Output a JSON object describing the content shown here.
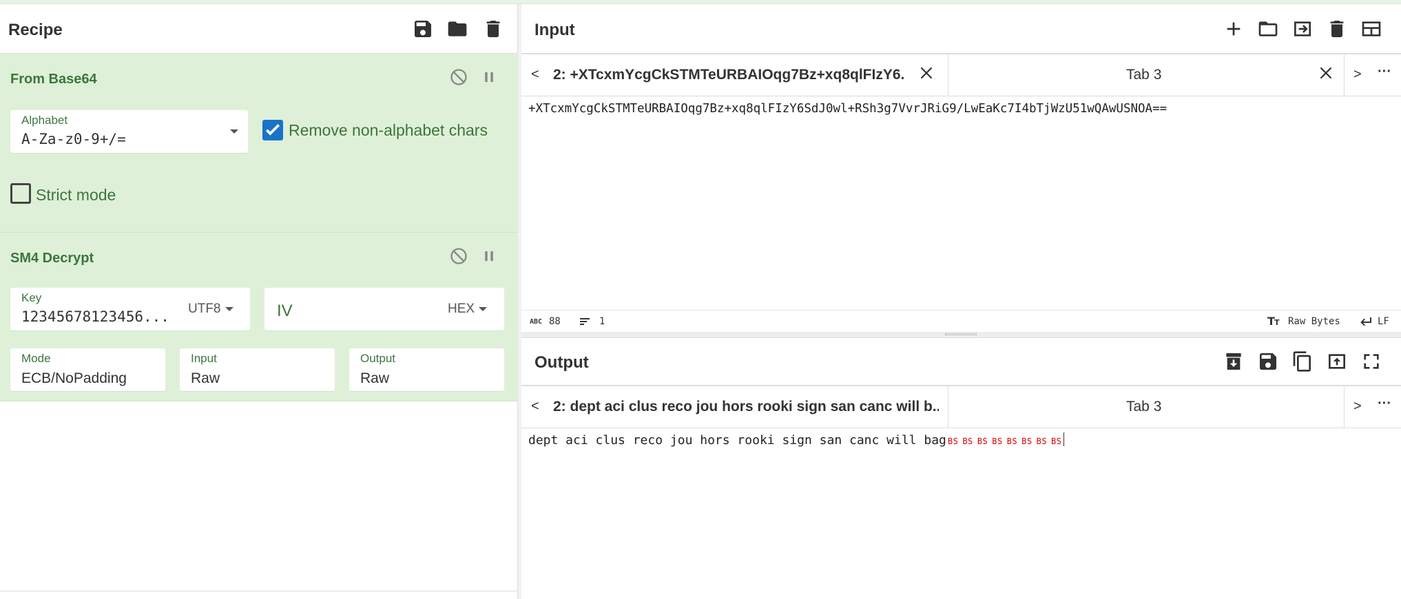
{
  "recipe": {
    "title": "Recipe",
    "operations": [
      {
        "name": "From Base64",
        "alphabet_label": "Alphabet",
        "alphabet_value": "A-Za-z0-9+/=",
        "remove_label": "Remove non-alphabet chars",
        "remove_checked": true,
        "strict_label": "Strict mode",
        "strict_checked": false
      },
      {
        "name": "SM4 Decrypt",
        "key_label": "Key",
        "key_value": "12345678123456...",
        "key_encoding": "UTF8",
        "iv_placeholder": "IV",
        "iv_encoding": "HEX",
        "mode_label": "Mode",
        "mode_value": "ECB/NoPadding",
        "input_label": "Input",
        "input_value": "Raw",
        "output_label": "Output",
        "output_value": "Raw"
      }
    ]
  },
  "input": {
    "title": "Input",
    "tab_prev": "<",
    "tab_next": ">",
    "tab_more": "···",
    "tabs": [
      {
        "label": "2: +XTcxmYcgCkSTMTeURBAIOqg7Bz+xq8qlFIzY6..."
      },
      {
        "label": "Tab 3"
      }
    ],
    "text": "+XTcxmYcgCkSTMTeURBAIOqg7Bz+xq8qlFIzY6SdJ0wl+RSh3g7VvrJRiG9/LwEaKc7I4bTjWzU51wQAwUSNOA==",
    "status": {
      "abc_icon_text": "ABC",
      "length": "88",
      "lines": "1",
      "format": "Raw Bytes",
      "eol": "LF"
    }
  },
  "output": {
    "title": "Output",
    "tab_prev": "<",
    "tab_next": ">",
    "tab_more": "···",
    "tabs": [
      {
        "label": "2: dept aci clus reco jou hors rooki sign san canc will b..."
      },
      {
        "label": "Tab 3"
      }
    ],
    "text": "dept aci clus reco jou hors rooki sign san canc will bag",
    "control_chars": [
      "BS",
      "BS",
      "BS",
      "BS",
      "BS",
      "BS",
      "BS",
      "BS"
    ]
  }
}
